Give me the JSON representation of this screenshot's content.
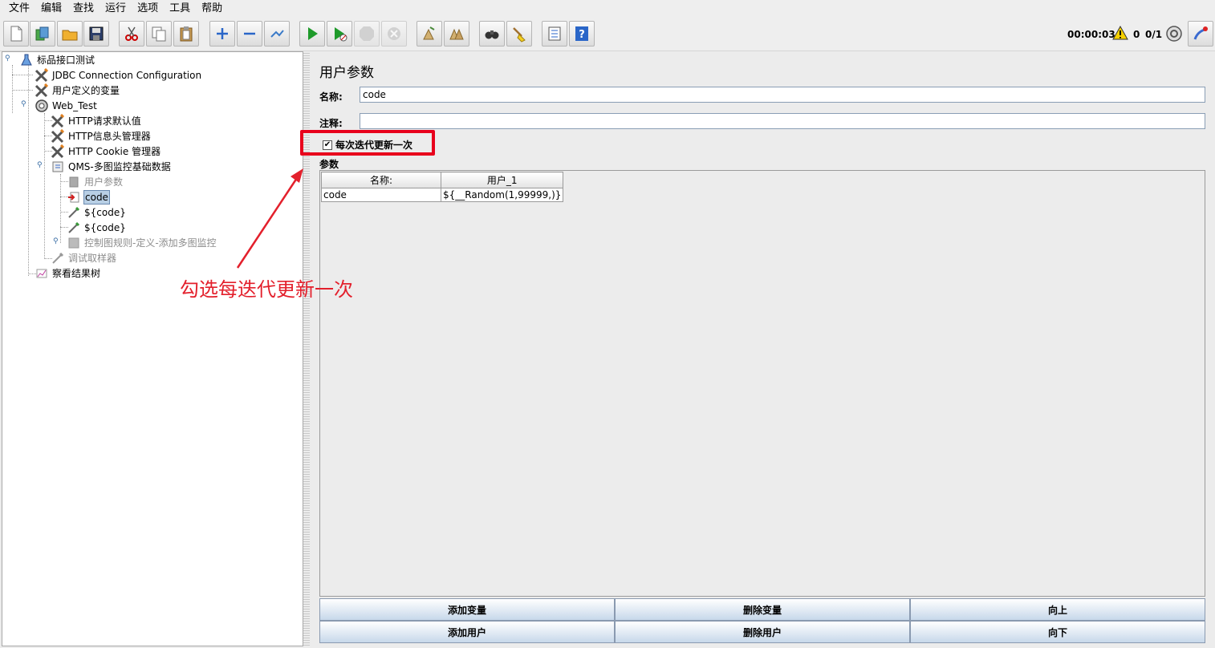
{
  "menu": [
    "文件",
    "编辑",
    "查找",
    "运行",
    "选项",
    "工具",
    "帮助"
  ],
  "toolbar": {
    "buttons": [
      {
        "name": "new-icon"
      },
      {
        "name": "templates-icon"
      },
      {
        "name": "open-icon"
      },
      {
        "name": "save-icon"
      },
      {
        "name": "cut-icon"
      },
      {
        "name": "copy-icon"
      },
      {
        "name": "paste-icon"
      },
      {
        "name": "expand-icon"
      },
      {
        "name": "collapse-icon"
      },
      {
        "name": "toggle-icon"
      },
      {
        "name": "start-icon"
      },
      {
        "name": "start-no-pauses-icon"
      },
      {
        "name": "stop-icon"
      },
      {
        "name": "shutdown-icon"
      },
      {
        "name": "clear-icon"
      },
      {
        "name": "clear-all-icon"
      },
      {
        "name": "search-icon"
      },
      {
        "name": "reset-search-icon"
      },
      {
        "name": "function-helper-icon"
      },
      {
        "name": "help-icon"
      }
    ],
    "timer": "00:00:03",
    "error_count": "0",
    "threads": "0/1"
  },
  "tree": {
    "root": "标品接口测试",
    "items": {
      "jdbc": "JDBC Connection Configuration",
      "user_vars": "用户定义的变量",
      "web_test": "Web_Test",
      "http_defaults": "HTTP请求默认值",
      "http_header": "HTTP信息头管理器",
      "http_cookie": "HTTP Cookie 管理器",
      "qms": "QMS-多图监控基础数据",
      "user_params": "用户参数",
      "code": "code",
      "code_ref1": "${code}",
      "code_ref2": "${code}",
      "ctrl_chart": "控制图规则-定义-添加多图监控",
      "debug_sampler": "调试取样器",
      "view_results": "察看结果树"
    }
  },
  "panel": {
    "title": "用户参数",
    "name_label": "名称:",
    "name_value": "code",
    "comment_label": "注释:",
    "comment_value": "",
    "checkbox_label": "每次迭代更新一次",
    "checkbox_checked": true,
    "params_label": "参数",
    "table": {
      "headers": [
        "名称:",
        "用户_1"
      ],
      "rows": [
        [
          "code",
          "${__Random(1,99999,)}"
        ]
      ]
    },
    "buttons": {
      "add_var": "添加变量",
      "del_var": "删除变量",
      "up": "向上",
      "add_user": "添加用户",
      "del_user": "删除用户",
      "down": "向下"
    }
  },
  "annotation": "勾选每迭代更新一次",
  "colors": {
    "highlight": "#e8001c",
    "annotation": "#e3202c",
    "selection": "#b8cfe5"
  }
}
